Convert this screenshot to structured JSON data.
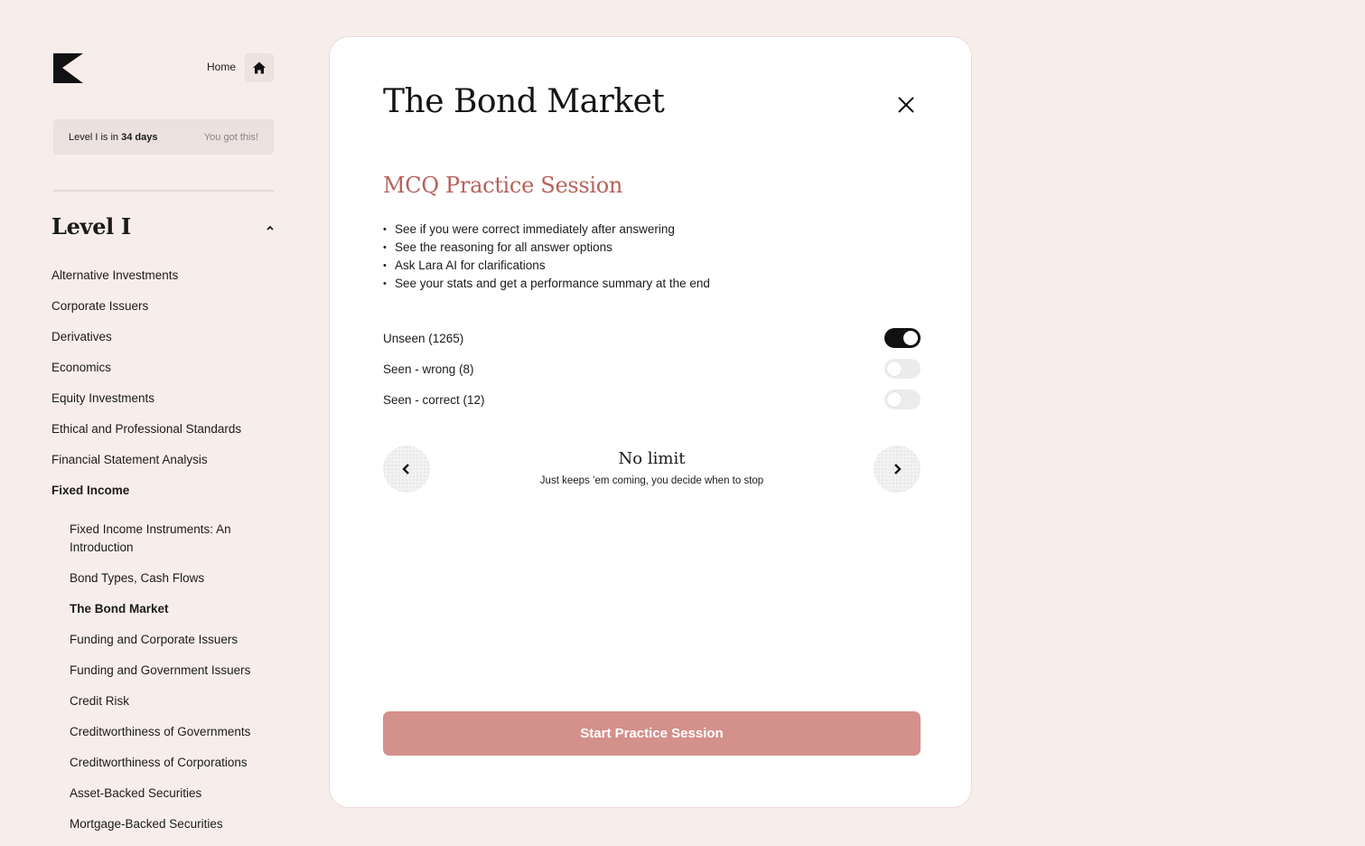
{
  "sidebar": {
    "home_label": "Home",
    "countdown": {
      "prefix": "Level I is in ",
      "days": "34 days",
      "cheer": "You got this!"
    },
    "level_title": "Level I",
    "topics": [
      "Alternative Investments",
      "Corporate Issuers",
      "Derivatives",
      "Economics",
      "Equity Investments",
      "Ethical and Professional Standards",
      "Financial Statement Analysis",
      "Fixed Income"
    ],
    "active_topic": "Fixed Income",
    "subtopics": [
      "Fixed Income Instruments: An Introduction",
      "Bond Types, Cash Flows",
      "The Bond Market",
      "Funding and Corporate Issuers",
      "Funding and Government Issuers",
      "Credit Risk",
      "Creditworthiness of Governments",
      "Creditworthiness of Corporations",
      "Asset-Backed Securities",
      "Mortgage-Backed Securities"
    ],
    "active_subtopic": "The Bond Market"
  },
  "modal": {
    "title": "The Bond Market",
    "section_title": "MCQ Practice Session",
    "features": [
      "See if you were correct immediately after answering",
      "See the reasoning for all answer options",
      "Ask Lara AI for clarifications",
      "See your stats and get a performance summary at the end"
    ],
    "filters": [
      {
        "label": "Unseen (1265)",
        "on": true
      },
      {
        "label": "Seen - wrong (8)",
        "on": false
      },
      {
        "label": "Seen - correct (12)",
        "on": false
      }
    ],
    "limit": {
      "title": "No limit",
      "subtitle": "Just keeps ’em coming, you decide when to stop"
    },
    "start_label": "Start Practice Session"
  },
  "colors": {
    "background": "#f7eeec",
    "accent_title": "#b7625b",
    "start_button": "#d4908b",
    "toggle_on": "#111111"
  }
}
